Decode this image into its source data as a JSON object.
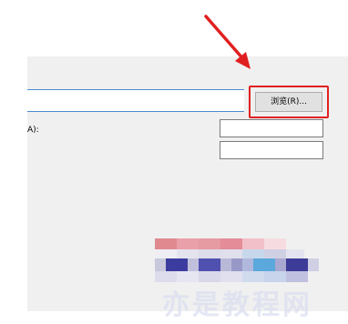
{
  "dialog": {
    "browse_button_label": "浏览(R)...",
    "field_label": "A):"
  },
  "colors": {
    "panel_bg": "#f0f0f0",
    "highlight": "#e02020",
    "field_focus": "#4a8bd4"
  },
  "annotation": {
    "arrow_icon": "red-arrow",
    "highlight_icon": "red-rectangle"
  },
  "watermark": {
    "text": "亦是教程网"
  }
}
